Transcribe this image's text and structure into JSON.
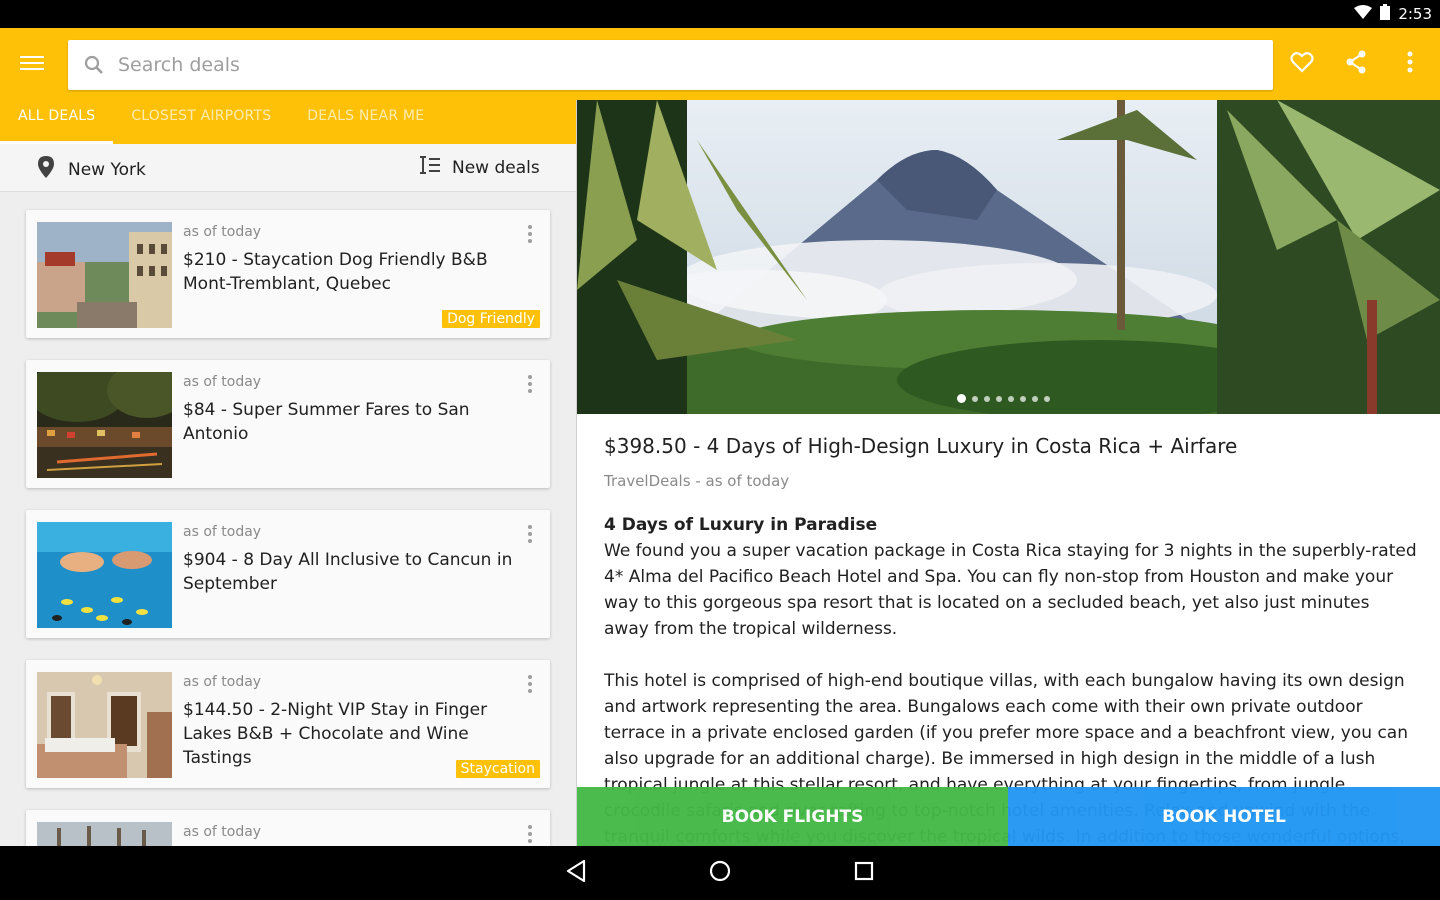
{
  "status": {
    "time": "2:53"
  },
  "search": {
    "placeholder": "Search deals"
  },
  "tabs": [
    {
      "label": "ALL DEALS"
    },
    {
      "label": "CLOSEST AIRPORTS"
    },
    {
      "label": "DEALS NEAR ME"
    }
  ],
  "filters": {
    "location": "New York",
    "sort": "New deals"
  },
  "deals": [
    {
      "date": "as of today",
      "title": "$210 - Staycation Dog Friendly B&B Mont-Tremblant, Quebec",
      "badge": "Dog Friendly"
    },
    {
      "date": "as of today",
      "title": "$84 - Super Summer Fares to San Antonio",
      "badge": ""
    },
    {
      "date": "as of today",
      "title": "$904 - 8 Day All Inclusive to Cancun in September",
      "badge": ""
    },
    {
      "date": "as of today",
      "title": "$144.50 - 2-Night VIP Stay in Finger Lakes B&B + Chocolate and Wine Tastings",
      "badge": "Staycation"
    },
    {
      "date": "as of today",
      "title": "",
      "badge": ""
    }
  ],
  "detail": {
    "title": "$398.50 - 4 Days of High-Design Luxury in Costa Rica + Airfare",
    "source": "TravelDeals",
    "date": " - as of today",
    "heading": "4 Days of Luxury in Paradise",
    "para1": "We found you a super vacation package in Costa Rica staying for 3 nights in the superbly-rated 4* Alma del Pacifico Beach Hotel and Spa. You can fly non-stop from Houston and make your way to this gorgeous spa resort that is located on a secluded beach, yet also just minutes away from the tropical wilderness.",
    "para2": "This hotel is comprised of high-end boutique villas, with each bungalow having its own design and artwork representing the area. Bungalows each come with their own private outdoor terrace in a private enclosed garden (if you prefer more space and a beachfront view, you can also upgrade for an additional charge). Be immersed in high design in the middle of a lush tropical jungle at this stellar resort, and have everything at your fingertips, from jungle crocodile safaris and river rafting to top-notch hotel amenities. Relax and unwind with the tranquil comforts while you discover the tropical wilds. In addition to those wonderful options, guests get"
  },
  "actions": {
    "book_flights": "BOOK FLIGHTS",
    "book_hotel": "BOOK HOTEL"
  },
  "colors": {
    "accent": "#ffc107",
    "flights": "#43b845",
    "hotel": "#2196f3"
  }
}
